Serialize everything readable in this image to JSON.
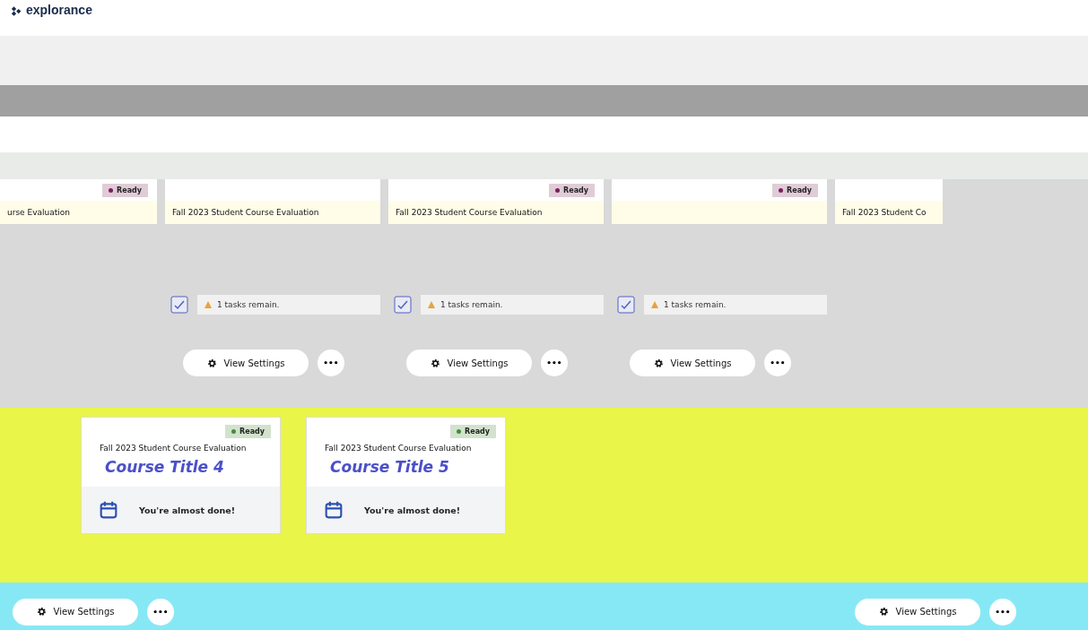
{
  "header": {
    "logo": "explorance"
  },
  "row_1": [
    {
      "subtitle": "urse Evaluation",
      "badge": {
        "label": "Ready",
        "color": "#7a1f5c"
      }
    },
    {
      "subtitle": "Fall 2023 Student Course Evaluation",
      "task": "1 tasks remain.",
      "buttons": [
        "View Settings",
        "•••"
      ]
    },
    {
      "subtitle": "Fall 2023 Student Course Evaluation",
      "badge": {
        "label": "Ready",
        "color": "#7a1f5c"
      },
      "task": "1 tasks remain.",
      "buttons": [
        "View Settings",
        "•••"
      ]
    },
    {
      "badge": {
        "label": "Ready",
        "color": "#7a1f5c"
      },
      "task": "1 tasks remain.",
      "buttons": [
        "View Settings",
        "•••"
      ]
    },
    {
      "subtitle": "Fall 2023 Student Co"
    }
  ],
  "row_2": [
    {
      "badge": {
        "label": "Ready",
        "color": "#3f8f3f"
      },
      "subtitle": "Fall 2023 Student Course Evaluation",
      "title": "Course Title 4",
      "message": "You're almost done!"
    },
    {
      "badge": {
        "label": "Ready",
        "color": "#3f8f3f"
      },
      "subtitle": "Fall 2023 Student Course Evaluation",
      "title": "Course Title 5",
      "message": "You're almost done!"
    }
  ],
  "bottom_actions": [
    {
      "buttons": [
        "View Settings",
        "•••"
      ]
    },
    {
      "buttons": [
        "View Settings",
        "•••"
      ]
    }
  ]
}
